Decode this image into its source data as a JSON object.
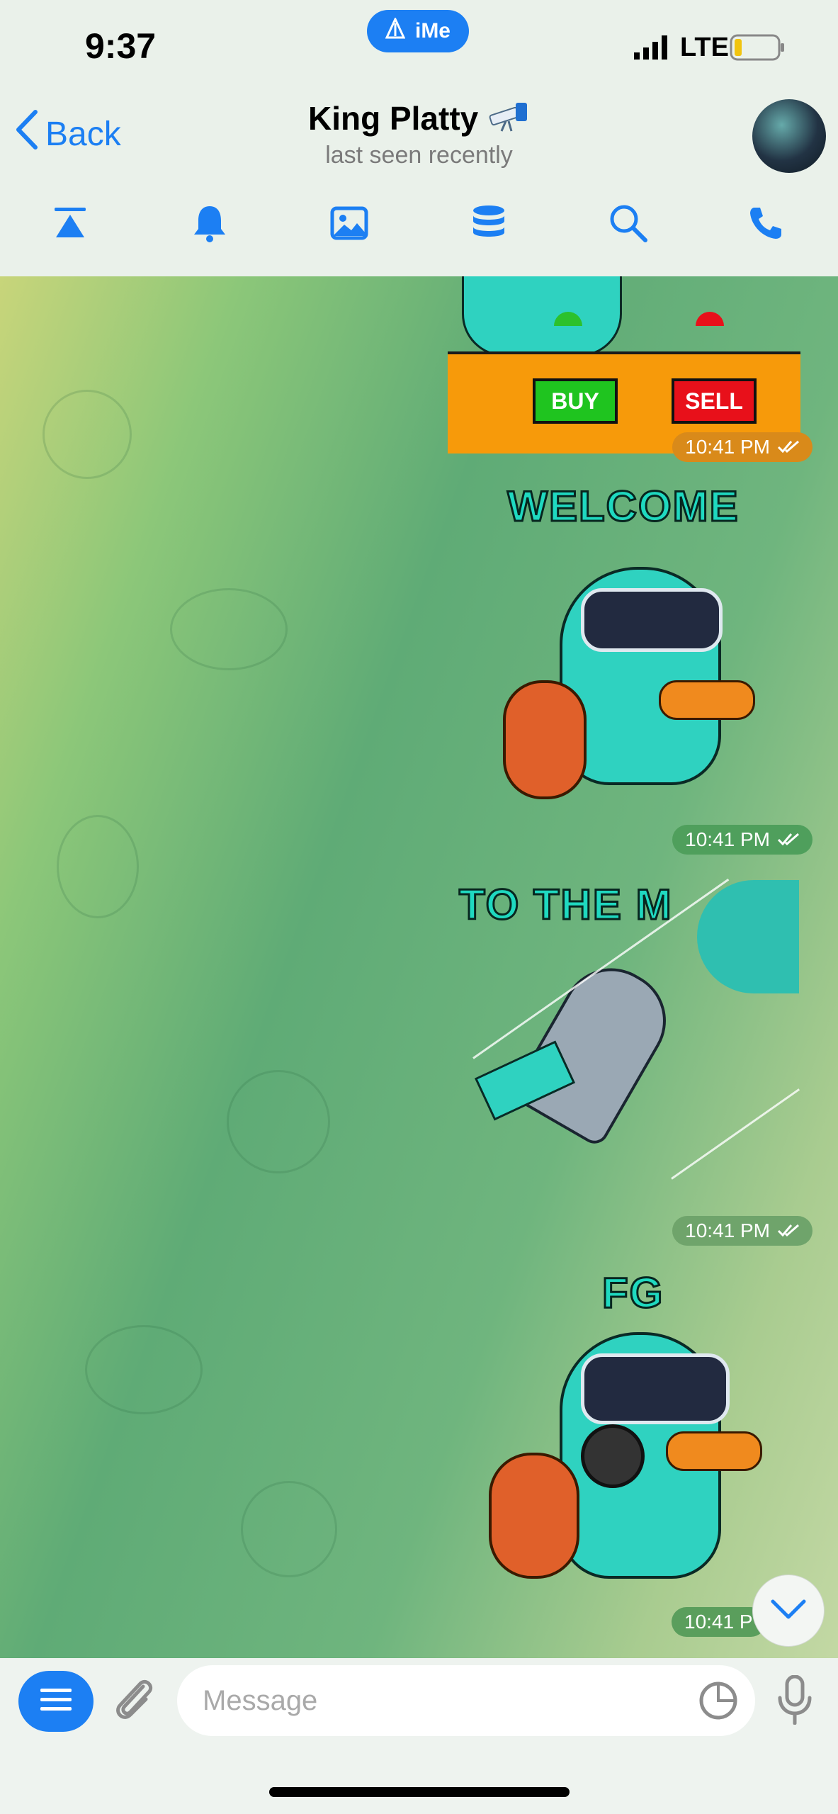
{
  "status_bar": {
    "time": "9:37",
    "ime_label": "iMe",
    "network": "LTE"
  },
  "header": {
    "back_label": "Back",
    "title": "King Platty",
    "subtitle": "last seen recently"
  },
  "toolbar": {
    "icons": [
      "pin-icon",
      "bell-icon",
      "image-icon",
      "database-icon",
      "search-icon",
      "phone-icon"
    ]
  },
  "messages": [
    {
      "type": "sticker",
      "texts": [
        "BUY",
        "SELL"
      ],
      "time": "10:41 PM"
    },
    {
      "type": "sticker",
      "texts": [
        "WELCOME"
      ],
      "time": "10:41 PM"
    },
    {
      "type": "sticker",
      "texts": [
        "TO THE M"
      ],
      "time": "10:41 PM"
    },
    {
      "type": "sticker",
      "texts": [
        "FG"
      ],
      "time": "10:41 P"
    }
  ],
  "composer": {
    "placeholder": "Message"
  },
  "colors": {
    "accent": "#1c7ff3",
    "sticker_teal": "#1fd9c0",
    "buy_green": "#1fc41f",
    "sell_red": "#e8101a",
    "orange": "#f79a0a"
  }
}
